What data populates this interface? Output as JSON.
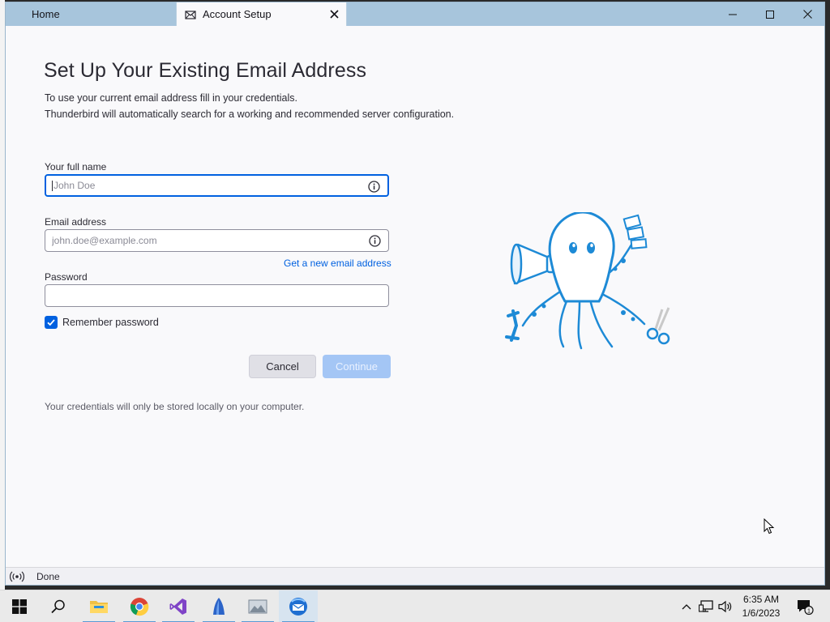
{
  "window": {
    "tabs": [
      {
        "label": "Home"
      },
      {
        "label": "Account Setup"
      }
    ]
  },
  "page": {
    "title": "Set Up Your Existing Email Address",
    "description_line1": "To use your current email address fill in your credentials.",
    "description_line2": "Thunderbird will automatically search for a working and recommended server configuration."
  },
  "form": {
    "full_name_label": "Your full name",
    "full_name_placeholder": "John Doe",
    "full_name_value": "",
    "email_label": "Email address",
    "email_placeholder": "john.doe@example.com",
    "email_value": "",
    "new_email_link": "Get a new email address",
    "password_label": "Password",
    "password_value": "",
    "remember_label": "Remember password",
    "remember_checked": true,
    "cancel_label": "Cancel",
    "continue_label": "Continue",
    "footnote": "Your credentials will only be stored locally on your computer."
  },
  "statusbar": {
    "text": "Done"
  },
  "taskbar": {
    "apps": [
      "start-icon",
      "search-icon",
      "file-explorer-icon",
      "chrome-icon",
      "visual-studio-icon",
      "app-icon",
      "photos-icon",
      "thunderbird-icon"
    ],
    "time": "6:35 AM",
    "date": "1/6/2023",
    "notification_count": "1"
  },
  "colors": {
    "accent": "#0061e0",
    "titlebar": "#a7c5dc",
    "continue_disabled": "#a4c6f5"
  }
}
